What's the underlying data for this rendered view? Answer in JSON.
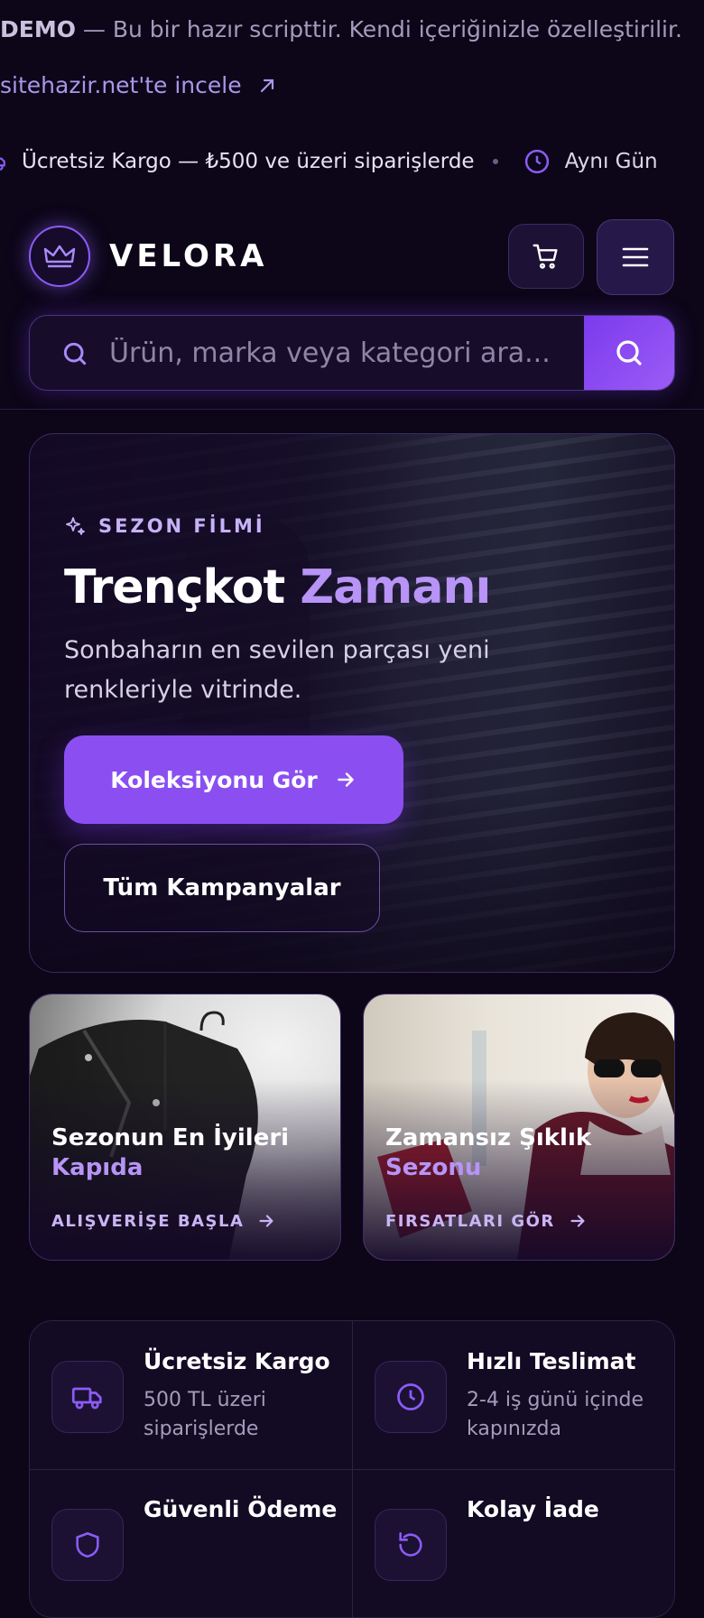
{
  "demo_banner": {
    "strong": "DEMO",
    "text": " — Bu bir hazır scripttir. Kendi içeriğinizle özelleştirilir.",
    "link_label": "sitehazir.net'te incele"
  },
  "ticker": {
    "items": [
      {
        "icon": "truck-icon",
        "text": "Ücretsiz Kargo — ₺500 ve üzeri siparişlerde"
      },
      {
        "icon": "clock-icon",
        "text": "Aynı Gün"
      }
    ]
  },
  "header": {
    "logo": "VELORA",
    "search_placeholder": "Ürün, marka veya kategori ara..."
  },
  "hero": {
    "eyebrow": "SEZON FİLMİ",
    "title_main": "Trençkot",
    "title_accent": "Zamanı",
    "description": "Sonbaharın en sevilen parçası yeni renkleriyle vitrinde.",
    "primary_button": "Koleksiyonu Gör",
    "secondary_button": "Tüm Kampanyalar"
  },
  "promos": [
    {
      "title": "Sezonun En İyileri",
      "accent": "Kapıda",
      "cta": "ALIŞVERİŞE BAŞLA"
    },
    {
      "title": "Zamansız Şıklık",
      "accent": "Sezonu",
      "cta": "FIRSATLARI GÖR"
    }
  ],
  "features": [
    {
      "icon": "truck-icon",
      "title": "Ücretsiz Kargo",
      "desc": "500 TL üzeri siparişlerde"
    },
    {
      "icon": "clock-icon",
      "title": "Hızlı Teslimat",
      "desc": "2-4 iş günü içinde kapınızda"
    },
    {
      "icon": "shield-icon",
      "title": "Güvenli Ödeme",
      "desc": ""
    },
    {
      "icon": "return-icon",
      "title": "Kolay İade",
      "desc": ""
    }
  ],
  "colors": {
    "background": "#0c0618",
    "accent": "#8b4ff1",
    "accent_text": "#b794f6"
  }
}
